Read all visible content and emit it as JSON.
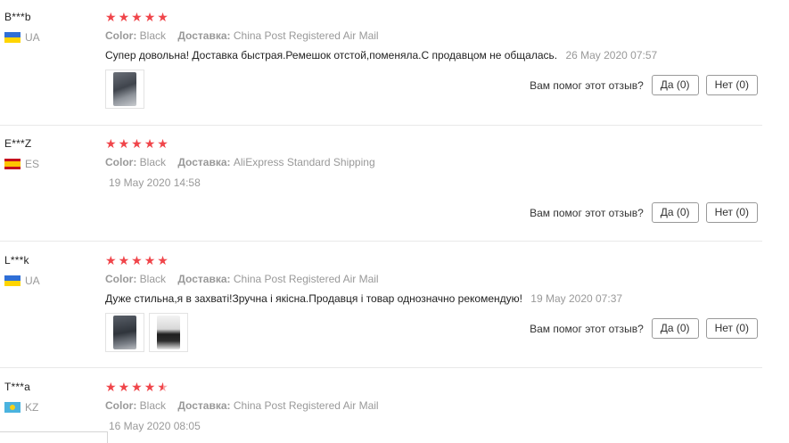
{
  "labels": {
    "color": "Color:",
    "shipping": "Доставка:",
    "helpful_question": "Вам помог этот отзыв?"
  },
  "accent_color": "#f0454a",
  "reviews": [
    {
      "user": "B***b",
      "country": "UA",
      "flag_icon": "ukraine-flag-icon",
      "rating": 5,
      "color": "Black",
      "shipping": "China Post Registered Air Mail",
      "text": "Супер довольна! Доставка быстрая.Ремешок отстой,поменяла.С продавцом не общалась.",
      "date": "26 May 2020 07:57",
      "photos": 1,
      "yes_label": "Да (0)",
      "no_label": "Нет (0)"
    },
    {
      "user": "E***Z",
      "country": "ES",
      "flag_icon": "spain-flag-icon",
      "rating": 5,
      "color": "Black",
      "shipping": "AliExpress Standard Shipping",
      "text": "",
      "date": "19 May 2020 14:58",
      "photos": 0,
      "yes_label": "Да (0)",
      "no_label": "Нет (0)"
    },
    {
      "user": "L***k",
      "country": "UA",
      "flag_icon": "ukraine-flag-icon",
      "rating": 5,
      "color": "Black",
      "shipping": "China Post Registered Air Mail",
      "text": "Дуже стильна,я в захваті!Зручна і якісна.Продавця і товар однозначно рекомендую!",
      "date": "19 May 2020 07:37",
      "photos": 2,
      "yes_label": "Да (0)",
      "no_label": "Нет (0)"
    },
    {
      "user": "T***a",
      "country": "KZ",
      "flag_icon": "kazakhstan-flag-icon",
      "rating": 4.5,
      "color": "Black",
      "shipping": "China Post Registered Air Mail",
      "text": "",
      "date": "16 May 2020 08:05",
      "photos": 0
    }
  ]
}
